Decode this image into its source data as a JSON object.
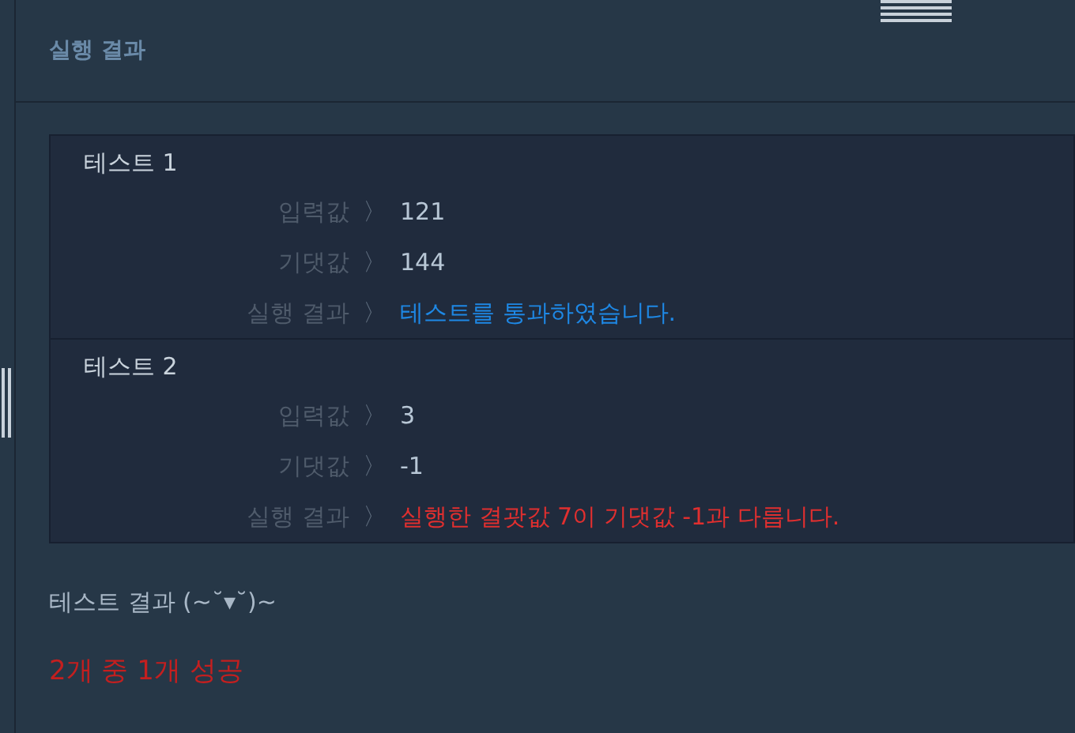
{
  "header": {
    "title": "실행 결과"
  },
  "tests": [
    {
      "title": "테스트 1",
      "rows": [
        {
          "label": "입력값",
          "sep": "〉",
          "value": "121"
        },
        {
          "label": "기댓값",
          "sep": "〉",
          "value": "144"
        }
      ],
      "result": {
        "label": "실행 결과",
        "sep": "〉",
        "kind": "pass",
        "text": "테스트를 통과하였습니다."
      }
    },
    {
      "title": "테스트 2",
      "rows": [
        {
          "label": "입력값",
          "sep": "〉",
          "value": "3"
        },
        {
          "label": "기댓값",
          "sep": "〉",
          "value": "-1"
        }
      ],
      "result": {
        "label": "실행 결과",
        "sep": "〉",
        "kind": "fail",
        "text": "실행한 결괏값 7이 기댓값 -1과 다릅니다."
      }
    }
  ],
  "summary": {
    "title": "테스트 결과 (~˘▾˘)~",
    "kind": "fail",
    "text": "2개 중 1개 성공"
  }
}
